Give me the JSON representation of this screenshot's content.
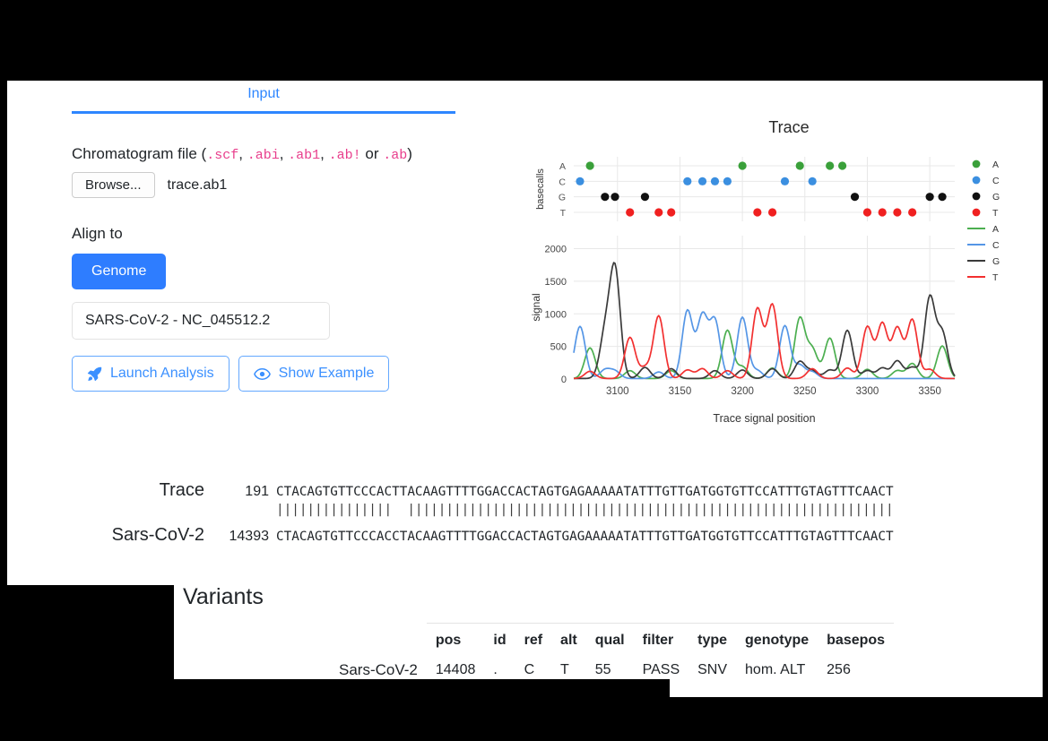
{
  "tabs": [
    {
      "label": "Input",
      "active": true
    }
  ],
  "form": {
    "chromatogram_label_prefix": "Chromatogram file (",
    "chromatogram_label_suffix": ")",
    "extensions": [
      ".scf",
      ".abi",
      ".ab1",
      ".ab!",
      ".ab"
    ],
    "extensions_joiner": ", ",
    "extensions_last_joiner": " or ",
    "browse_label": "Browse...",
    "file_name": "trace.ab1",
    "align_to_label": "Align to",
    "genome_button": "Genome",
    "genome_select_value": "SARS-CoV-2 - NC_045512.2",
    "launch_button": "Launch Analysis",
    "example_button": "Show Example",
    "accent_blue": "#2e7dff",
    "ext_pink": "#e83e8c"
  },
  "chart_data": {
    "type": "line",
    "title": "Trace",
    "xlabel": "Trace signal position",
    "ylabel": "signal",
    "basecalls_ylabel": "basecalls",
    "xlim": [
      3065,
      3370
    ],
    "xticks": [
      3100,
      3150,
      3200,
      3250,
      3300,
      3350
    ],
    "ylim": [
      0,
      2200
    ],
    "yticks": [
      0,
      500,
      1000,
      1500,
      2000
    ],
    "grid": true,
    "legend_position": "right",
    "legend": [
      {
        "label": "A",
        "color": "#3aa03a",
        "marker": "dot"
      },
      {
        "label": "C",
        "color": "#3b8fe0",
        "marker": "dot"
      },
      {
        "label": "G",
        "color": "#111111",
        "marker": "dot"
      },
      {
        "label": "T",
        "color": "#f02020",
        "marker": "dot"
      },
      {
        "label": "A",
        "color": "#4caf50",
        "marker": "line"
      },
      {
        "label": "C",
        "color": "#5596e6",
        "marker": "line"
      },
      {
        "label": "G",
        "color": "#3a3a3a",
        "marker": "line"
      },
      {
        "label": "T",
        "color": "#f23030",
        "marker": "line"
      }
    ],
    "basecall_rows": [
      "A",
      "C",
      "G",
      "T"
    ],
    "basecalls": [
      {
        "x": 3070,
        "base": "C"
      },
      {
        "x": 3078,
        "base": "A"
      },
      {
        "x": 3090,
        "base": "G"
      },
      {
        "x": 3098,
        "base": "G"
      },
      {
        "x": 3110,
        "base": "T"
      },
      {
        "x": 3122,
        "base": "G"
      },
      {
        "x": 3133,
        "base": "T"
      },
      {
        "x": 3143,
        "base": "T"
      },
      {
        "x": 3156,
        "base": "C"
      },
      {
        "x": 3168,
        "base": "C"
      },
      {
        "x": 3178,
        "base": "C"
      },
      {
        "x": 3188,
        "base": "C"
      },
      {
        "x": 3200,
        "base": "A"
      },
      {
        "x": 3212,
        "base": "T"
      },
      {
        "x": 3224,
        "base": "T"
      },
      {
        "x": 3234,
        "base": "C"
      },
      {
        "x": 3246,
        "base": "A"
      },
      {
        "x": 3256,
        "base": "C"
      },
      {
        "x": 3270,
        "base": "A"
      },
      {
        "x": 3280,
        "base": "A"
      },
      {
        "x": 3290,
        "base": "G"
      },
      {
        "x": 3300,
        "base": "T"
      },
      {
        "x": 3312,
        "base": "T"
      },
      {
        "x": 3324,
        "base": "T"
      },
      {
        "x": 3336,
        "base": "T"
      },
      {
        "x": 3350,
        "base": "G"
      },
      {
        "x": 3360,
        "base": "G"
      }
    ],
    "series": [
      {
        "name": "A",
        "color": "#4caf50",
        "peaks": [
          [
            3078,
            470
          ],
          [
            3110,
            120
          ],
          [
            3143,
            120
          ],
          [
            3188,
            740
          ],
          [
            3200,
            180
          ],
          [
            3224,
            160
          ],
          [
            3246,
            920
          ],
          [
            3256,
            440
          ],
          [
            3270,
            620
          ],
          [
            3300,
            140
          ],
          [
            3324,
            120
          ],
          [
            3336,
            230
          ],
          [
            3360,
            500
          ]
        ]
      },
      {
        "name": "C",
        "color": "#5596e6",
        "peaks": [
          [
            3070,
            800
          ],
          [
            3090,
            130
          ],
          [
            3098,
            110
          ],
          [
            3133,
            100
          ],
          [
            3156,
            1040
          ],
          [
            3168,
            950
          ],
          [
            3178,
            880
          ],
          [
            3200,
            940
          ],
          [
            3212,
            120
          ],
          [
            3234,
            810
          ],
          [
            3246,
            200
          ],
          [
            3256,
            100
          ]
        ]
      },
      {
        "name": "G",
        "color": "#3a3a3a",
        "peaks": [
          [
            3090,
            660
          ],
          [
            3098,
            1660
          ],
          [
            3122,
            170
          ],
          [
            3143,
            150
          ],
          [
            3178,
            120
          ],
          [
            3200,
            130
          ],
          [
            3224,
            150
          ],
          [
            3246,
            260
          ],
          [
            3256,
            120
          ],
          [
            3270,
            130
          ],
          [
            3284,
            740
          ],
          [
            3300,
            120
          ],
          [
            3312,
            160
          ],
          [
            3324,
            270
          ],
          [
            3336,
            170
          ],
          [
            3350,
            1240
          ],
          [
            3360,
            690
          ]
        ]
      },
      {
        "name": "T",
        "color": "#f23030",
        "peaks": [
          [
            3078,
            110
          ],
          [
            3110,
            630
          ],
          [
            3122,
            160
          ],
          [
            3133,
            960
          ],
          [
            3156,
            130
          ],
          [
            3168,
            150
          ],
          [
            3188,
            120
          ],
          [
            3212,
            1070
          ],
          [
            3224,
            1130
          ],
          [
            3256,
            150
          ],
          [
            3284,
            160
          ],
          [
            3300,
            790
          ],
          [
            3312,
            840
          ],
          [
            3324,
            770
          ],
          [
            3336,
            900
          ],
          [
            3350,
            140
          ]
        ]
      }
    ]
  },
  "alignment": {
    "rows": [
      {
        "name": "Trace",
        "pos": "191",
        "seq": "CTACAGTGTTCCCACTTACAAGTTTTGGACCACTAGTGAGAAAAATATTTGTTGATGGTGTTCCATTTGTAGTTTCAACT"
      },
      {
        "name": "Sars-CoV-2",
        "pos": "14393",
        "seq": "CTACAGTGTTCCCACCTACAAGTTTTGGACCACTAGTGAGAAAAATATTTGTTGATGGTGTTCCATTTGTAGTTTCAACT"
      }
    ],
    "match_line": "|||||||||||||||  |||||||||||||||||||||||||||||||||||||||||||||||||||||||||||||||"
  },
  "variants": {
    "title": "Variants",
    "columns": [
      "",
      "pos",
      "id",
      "ref",
      "alt",
      "qual",
      "filter",
      "type",
      "genotype",
      "basepos"
    ],
    "rows": [
      {
        "name": "Sars-CoV-2",
        "pos": "14408",
        "id": ".",
        "ref": "C",
        "alt": "T",
        "qual": "55",
        "filter": "PASS",
        "type": "SNV",
        "genotype": "hom. ALT",
        "basepos": "256"
      }
    ]
  }
}
